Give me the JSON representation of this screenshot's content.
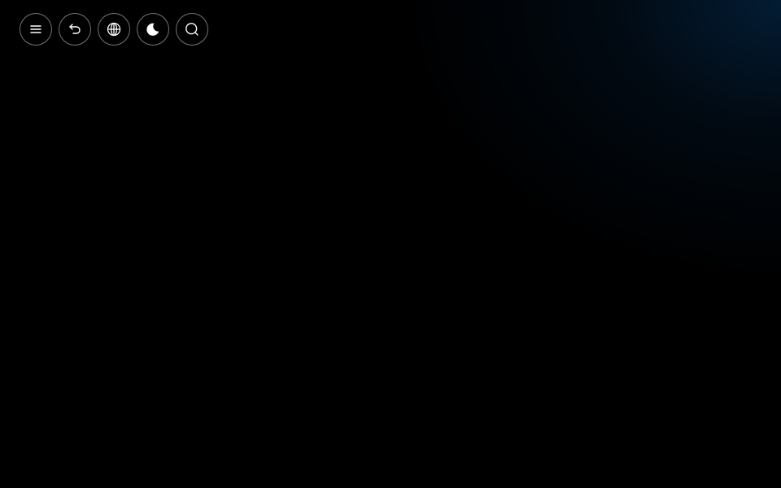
{
  "toolbar": {
    "buttons": [
      {
        "id": "menu",
        "icon": "menu-icon"
      },
      {
        "id": "back",
        "icon": "undo-arrow-icon"
      },
      {
        "id": "language",
        "icon": "globe-icon"
      },
      {
        "id": "theme",
        "icon": "moon-icon"
      },
      {
        "id": "search",
        "icon": "search-icon"
      }
    ]
  },
  "theme": {
    "background": "#000000",
    "glow": "#06345e",
    "button_border": "#8c8c8c",
    "icon_color": "#ffffff"
  }
}
